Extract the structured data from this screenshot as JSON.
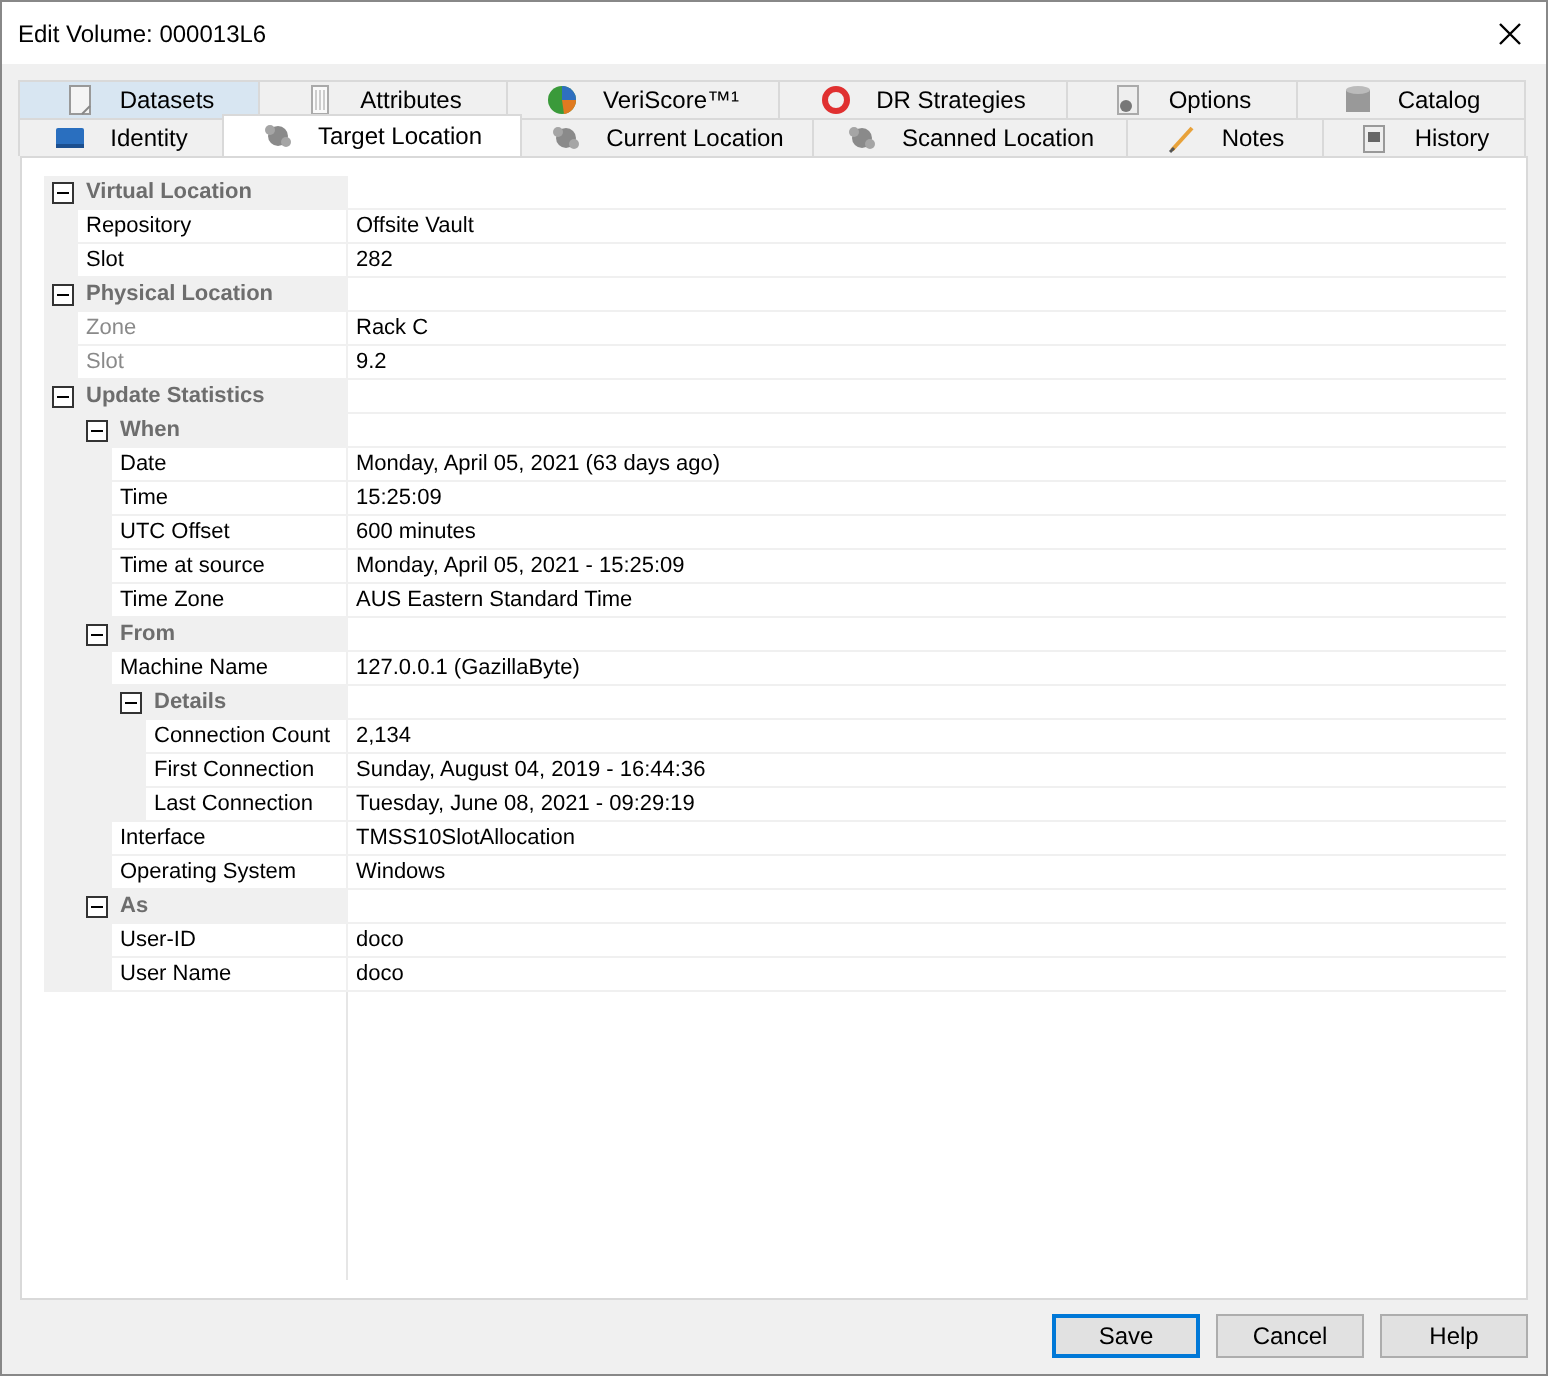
{
  "window": {
    "title": "Edit Volume: 000013L6"
  },
  "tab_rows": [
    [
      {
        "label": "Datasets",
        "selected": false,
        "highlighted": true
      },
      {
        "label": "Attributes",
        "selected": false,
        "highlighted": false
      },
      {
        "label": "VeriScore™¹",
        "selected": false,
        "highlighted": false
      },
      {
        "label": "DR Strategies",
        "selected": false,
        "highlighted": false
      },
      {
        "label": "Options",
        "selected": false,
        "highlighted": false
      },
      {
        "label": "Catalog",
        "selected": false,
        "highlighted": false
      }
    ],
    [
      {
        "label": "Identity",
        "selected": false,
        "highlighted": false
      },
      {
        "label": "Target Location",
        "selected": true,
        "highlighted": false
      },
      {
        "label": "Current Location",
        "selected": false,
        "highlighted": false
      },
      {
        "label": "Scanned Location",
        "selected": false,
        "highlighted": false
      },
      {
        "label": "Notes",
        "selected": false,
        "highlighted": false
      },
      {
        "label": "History",
        "selected": false,
        "highlighted": false
      }
    ]
  ],
  "property_grid": [
    {
      "kind": "category",
      "label": "Virtual Location",
      "expanded": true,
      "children": [
        {
          "kind": "property",
          "label": "Repository",
          "value": "Offsite Vault",
          "disabled": false
        },
        {
          "kind": "property",
          "label": "Slot",
          "value": "282",
          "disabled": false
        }
      ]
    },
    {
      "kind": "category",
      "label": "Physical Location",
      "expanded": true,
      "children": [
        {
          "kind": "property",
          "label": "Zone",
          "value": "Rack C",
          "disabled": true
        },
        {
          "kind": "property",
          "label": "Slot",
          "value": "9.2",
          "disabled": true
        }
      ]
    },
    {
      "kind": "category",
      "label": "Update Statistics",
      "expanded": true,
      "children": [
        {
          "kind": "category",
          "label": "When",
          "expanded": true,
          "children": [
            {
              "kind": "property",
              "label": "Date",
              "value": "Monday, April 05, 2021 (63 days ago)",
              "disabled": false
            },
            {
              "kind": "property",
              "label": "Time",
              "value": "15:25:09",
              "disabled": false
            },
            {
              "kind": "property",
              "label": "UTC Offset",
              "value": "600 minutes",
              "disabled": false
            },
            {
              "kind": "property",
              "label": "Time at source",
              "value": "Monday, April 05, 2021 - 15:25:09",
              "disabled": false
            },
            {
              "kind": "property",
              "label": "Time Zone",
              "value": "AUS Eastern Standard Time",
              "disabled": false
            }
          ]
        },
        {
          "kind": "category",
          "label": "From",
          "expanded": true,
          "children": [
            {
              "kind": "property",
              "label": "Machine Name",
              "value": "127.0.0.1 (GazillaByte)",
              "disabled": false
            },
            {
              "kind": "category",
              "label": "Details",
              "expanded": true,
              "children": [
                {
                  "kind": "property",
                  "label": "Connection Count",
                  "value": "2,134",
                  "disabled": false
                },
                {
                  "kind": "property",
                  "label": "First Connection",
                  "value": "Sunday, August 04, 2019 - 16:44:36",
                  "disabled": false
                },
                {
                  "kind": "property",
                  "label": "Last Connection",
                  "value": "Tuesday, June 08, 2021 - 09:29:19",
                  "disabled": false
                }
              ]
            },
            {
              "kind": "property",
              "label": "Interface",
              "value": "TMSS10SlotAllocation",
              "disabled": false
            },
            {
              "kind": "property",
              "label": "Operating System",
              "value": "Windows",
              "disabled": false
            }
          ]
        },
        {
          "kind": "category",
          "label": "As",
          "expanded": true,
          "children": [
            {
              "kind": "property",
              "label": "User-ID",
              "value": "doco",
              "disabled": false
            },
            {
              "kind": "property",
              "label": "User Name",
              "value": "doco",
              "disabled": false
            }
          ]
        }
      ]
    }
  ],
  "buttons": [
    {
      "label": "Save",
      "default": true
    },
    {
      "label": "Cancel",
      "default": false
    },
    {
      "label": "Help",
      "default": false
    }
  ]
}
